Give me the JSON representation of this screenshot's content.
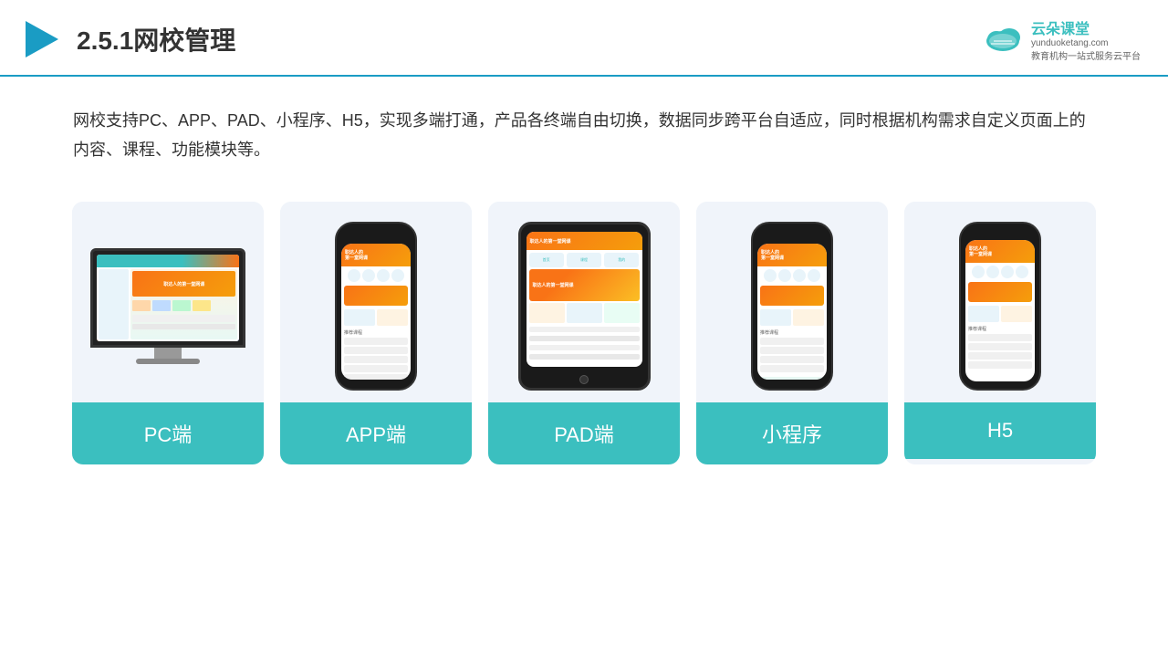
{
  "header": {
    "title": "2.5.1网校管理",
    "logo_url": "yunduoketang.com",
    "logo_name": "云朵课堂",
    "logo_tagline_line1": "教育机构一站",
    "logo_tagline_line2": "式服务云平台"
  },
  "description": {
    "text": "网校支持PC、APP、PAD、小程序、H5，实现多端打通，产品各终端自由切换，数据同步跨平台自适应，同时根据机构需求自定义页面上的内容、课程、功能模块等。"
  },
  "cards": [
    {
      "id": "pc",
      "label": "PC端"
    },
    {
      "id": "app",
      "label": "APP端"
    },
    {
      "id": "pad",
      "label": "PAD端"
    },
    {
      "id": "mini",
      "label": "小程序"
    },
    {
      "id": "h5",
      "label": "H5"
    }
  ],
  "colors": {
    "accent": "#3bbfbf",
    "header_border": "#1a9cc4",
    "card_bg": "#f0f4fa",
    "text_dark": "#333333",
    "text_gray": "#666666"
  }
}
